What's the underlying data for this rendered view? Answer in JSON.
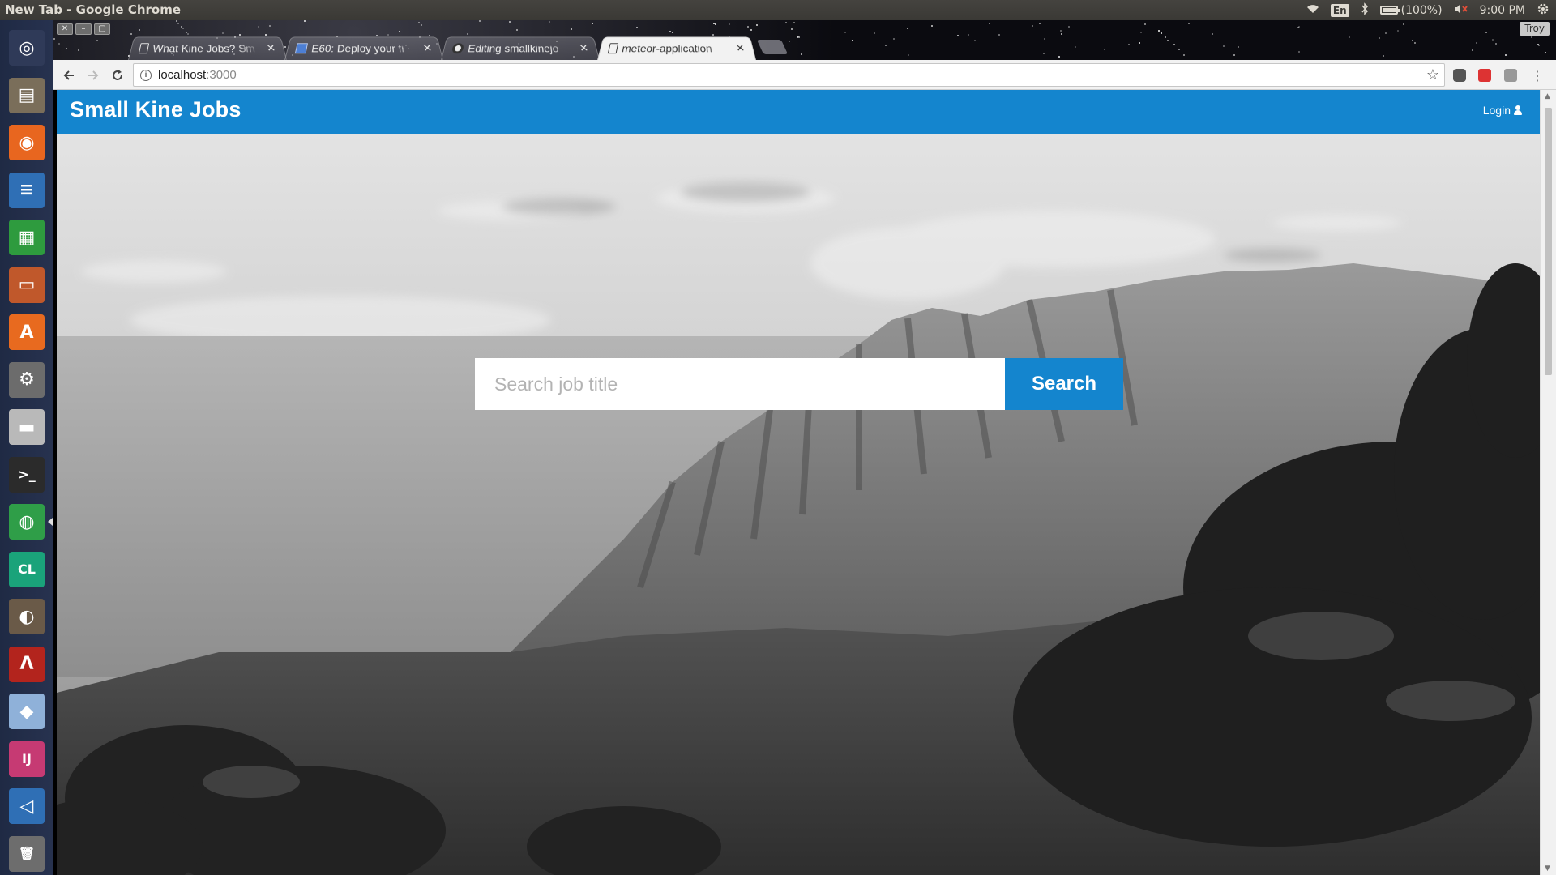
{
  "os": {
    "window_title": "New Tab - Google Chrome",
    "indicators": {
      "language": "En",
      "battery": "(100%)",
      "clock": "9:00 PM"
    },
    "launcher": [
      {
        "name": "ubuntu-dash",
        "icon": "ubuntu-logo-icon"
      },
      {
        "name": "files",
        "icon": "file-cabinet-icon"
      },
      {
        "name": "firefox",
        "icon": "firefox-icon"
      },
      {
        "name": "libreoffice-writer",
        "icon": "writer-icon"
      },
      {
        "name": "libreoffice-calc",
        "icon": "calc-icon"
      },
      {
        "name": "libreoffice-impress",
        "icon": "impress-icon"
      },
      {
        "name": "software-center",
        "icon": "shopping-bag-icon"
      },
      {
        "name": "system-settings",
        "icon": "settings-wrench-icon"
      },
      {
        "name": "disk",
        "icon": "hard-drive-icon"
      },
      {
        "name": "terminal",
        "icon": "terminal-icon"
      },
      {
        "name": "chrome",
        "icon": "chrome-icon"
      },
      {
        "name": "clion",
        "icon": "clion-icon"
      },
      {
        "name": "gimp",
        "icon": "gimp-icon"
      },
      {
        "name": "atom",
        "icon": "atom-icon"
      },
      {
        "name": "virtualbox",
        "icon": "cube-icon"
      },
      {
        "name": "intellij",
        "icon": "intellij-icon"
      },
      {
        "name": "vscode",
        "icon": "vscode-icon"
      },
      {
        "name": "trash",
        "icon": "trash-icon"
      }
    ]
  },
  "browser": {
    "profile": "Troy",
    "tabs": [
      {
        "label": "What Kine Jobs? Sm",
        "favicon": "document-icon",
        "active": false
      },
      {
        "label": "E60: Deploy your fi",
        "favicon": "blue-square-icon",
        "active": false
      },
      {
        "label": "Editing smallkinejo",
        "favicon": "github-icon",
        "active": false
      },
      {
        "label": "meteor-application",
        "favicon": "document-icon",
        "active": true
      }
    ],
    "url": {
      "host": "localhost",
      "port": ":3000"
    }
  },
  "page": {
    "brand": "Small Kine Jobs",
    "login_label": "Login",
    "search": {
      "placeholder": "Search job title",
      "value": "",
      "button_label": "Search"
    }
  },
  "colors": {
    "primary": "#1485ce"
  }
}
